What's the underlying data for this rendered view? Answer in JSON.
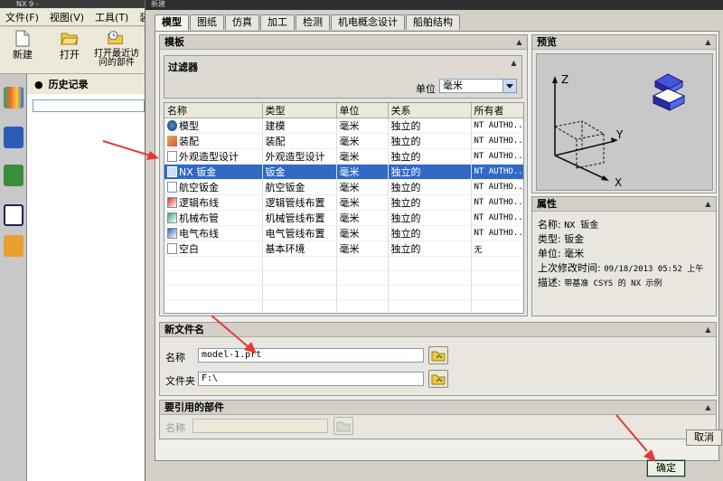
{
  "app": {
    "title": "NX 9 -",
    "menus": [
      "文件(F)",
      "视图(V)",
      "工具(T)",
      "装配"
    ],
    "toolbar": [
      {
        "label": "新建",
        "icon": "new-file-icon"
      },
      {
        "label": "打开",
        "icon": "open-folder-icon"
      },
      {
        "label": "打开最近访问的部件",
        "icon": "open-recent-icon"
      }
    ],
    "history_label": "历史记录"
  },
  "dialog": {
    "title": "新建",
    "tabs": [
      "模型",
      "图纸",
      "仿真",
      "加工",
      "检测",
      "机电概念设计",
      "船舶结构"
    ],
    "active_tab": "模型",
    "templates": {
      "header": "模板",
      "filter_header": "过滤器",
      "unit_label": "单位",
      "unit_value": "毫米",
      "columns": [
        "名称",
        "类型",
        "单位",
        "关系",
        "所有者"
      ],
      "rows": [
        {
          "name": "模型",
          "type": "建模",
          "unit": "毫米",
          "relation": "独立的",
          "owner": "NT AUTHO...",
          "icon": "model-icon",
          "selected": false
        },
        {
          "name": "装配",
          "type": "装配",
          "unit": "毫米",
          "relation": "独立的",
          "owner": "NT AUTHO...",
          "icon": "assembly-icon",
          "selected": false
        },
        {
          "name": "外观造型设计",
          "type": "外观造型设计",
          "unit": "毫米",
          "relation": "独立的",
          "owner": "NT AUTHO...",
          "icon": "shape-studio-icon",
          "selected": false
        },
        {
          "name": "NX 钣金",
          "type": "钣金",
          "unit": "毫米",
          "relation": "独立的",
          "owner": "NT AUTHO...",
          "icon": "sheet-metal-icon",
          "selected": true
        },
        {
          "name": "航空钣金",
          "type": "航空钣金",
          "unit": "毫米",
          "relation": "独立的",
          "owner": "NT AUTHO...",
          "icon": "aero-sheet-metal-icon",
          "selected": false
        },
        {
          "name": "逻辑布线",
          "type": "逻辑管线布置",
          "unit": "毫米",
          "relation": "独立的",
          "owner": "NT AUTHO...",
          "icon": "logical-routing-icon",
          "selected": false
        },
        {
          "name": "机械布管",
          "type": "机械管线布置",
          "unit": "毫米",
          "relation": "独立的",
          "owner": "NT AUTHO...",
          "icon": "mechanical-routing-icon",
          "selected": false
        },
        {
          "name": "电气布线",
          "type": "电气管线布置",
          "unit": "毫米",
          "relation": "独立的",
          "owner": "NT AUTHO...",
          "icon": "electrical-routing-icon",
          "selected": false
        },
        {
          "name": "空白",
          "type": "基本环境",
          "unit": "毫米",
          "relation": "独立的",
          "owner": "无",
          "icon": "blank-icon",
          "selected": false
        }
      ]
    },
    "preview": {
      "header": "预览",
      "axis_labels": {
        "x": "X",
        "y": "Y",
        "z": "Z"
      }
    },
    "properties": {
      "header": "属性",
      "items": [
        {
          "label": "名称:",
          "value": "NX 钣金"
        },
        {
          "label": "类型:",
          "value": "钣金"
        },
        {
          "label": "单位:",
          "value": "毫米"
        },
        {
          "label": "上次修改时间:",
          "value": "09/18/2013 05:52 上午"
        },
        {
          "label": "描述:",
          "value": "带基准 CSYS 的 NX 示例"
        }
      ]
    },
    "new_file": {
      "header": "新文件名",
      "name_label": "名称",
      "name_value": "model-1.prt",
      "folder_label": "文件夹",
      "folder_value": "F:\\"
    },
    "referenced_part": {
      "header": "要引用的部件",
      "name_label": "名称",
      "name_value": ""
    },
    "ok_label": "确定",
    "cancel_label": "取消"
  },
  "colors": {
    "selection": "#316ac5",
    "annotation_arrow": "#e53935",
    "dialog_bg": "#d4d0c8"
  }
}
